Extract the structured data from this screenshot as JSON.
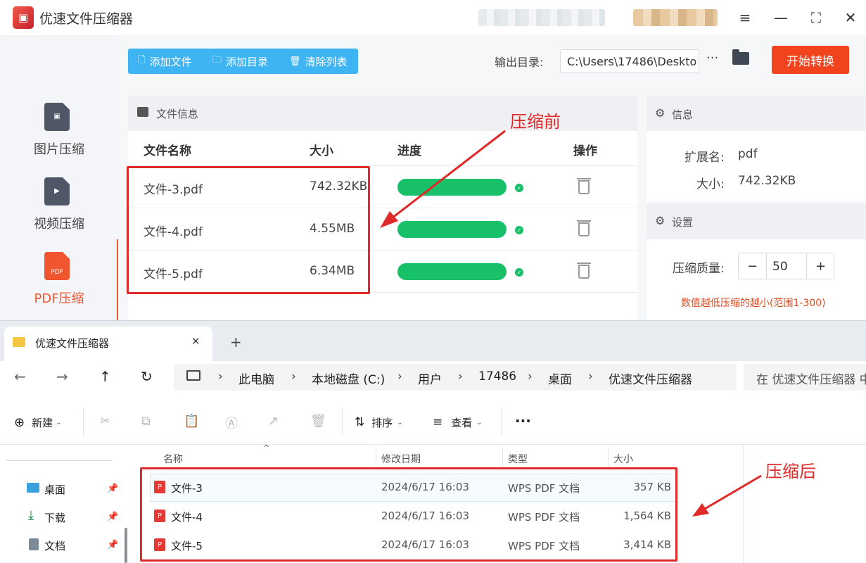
{
  "app": {
    "title": "优速文件压缩器",
    "logo_glyph": "▣"
  },
  "sidebar": {
    "items": [
      {
        "label": "图片压缩",
        "icon": "image-file-icon",
        "active": false
      },
      {
        "label": "视频压缩",
        "icon": "video-file-icon",
        "active": false
      },
      {
        "label": "PDF压缩",
        "icon": "pdf-file-icon",
        "active": true,
        "icon_text": "PDF"
      }
    ],
    "active_color": "#f0552f"
  },
  "toolbar": {
    "add_file": "添加文件",
    "add_folder": "添加目录",
    "clear_list": "清除列表",
    "output_label": "输出目录:",
    "output_path": "C:\\Users\\17486\\Deskto",
    "more": "···",
    "start_button": "开始转换",
    "accent": "#3fb4f2",
    "start_color": "#f0431e"
  },
  "file_panel": {
    "title": "文件信息",
    "columns": [
      "文件名称",
      "大小",
      "进度",
      "操作"
    ],
    "rows": [
      {
        "name": "文件-3.pdf",
        "size": "742.32KB",
        "progress": 1.0
      },
      {
        "name": "文件-4.pdf",
        "size": "4.55MB",
        "progress": 1.0
      },
      {
        "name": "文件-5.pdf",
        "size": "6.34MB",
        "progress": 1.0
      }
    ],
    "progress_color": "#19c06a"
  },
  "info_panel": {
    "title": "信息",
    "ext_label": "扩展名:",
    "ext_value": "pdf",
    "size_label": "大小:",
    "size_value": "742.32KB"
  },
  "settings_panel": {
    "title": "设置",
    "quality_label": "压缩质量:",
    "quality_value": "50",
    "minus": "−",
    "plus": "+",
    "hint": "数值越低压缩的越小(范围1-300)"
  },
  "annotations": {
    "before": "压缩前",
    "after": "压缩后",
    "color": "#e02a2a"
  },
  "explorer": {
    "tab_title": "优速文件压缩器",
    "tab_close": "✕",
    "new_tab": "+",
    "breadcrumbs": [
      "此电脑",
      "本地磁盘 (C:)",
      "用户",
      "17486",
      "桌面",
      "优速文件压缩器"
    ],
    "search_placeholder": "在 优速文件压缩器 中",
    "commands": {
      "new": "新建",
      "sort": "排序",
      "view": "查看",
      "more": "···"
    },
    "nav_items": [
      {
        "label": "桌面"
      },
      {
        "label": "下载"
      },
      {
        "label": "文档"
      }
    ],
    "columns": [
      "名称",
      "修改日期",
      "类型",
      "大小"
    ],
    "files": [
      {
        "name": "文件-3",
        "date": "2024/6/17 16:03",
        "type": "WPS PDF 文档",
        "size": "357 KB"
      },
      {
        "name": "文件-4",
        "date": "2024/6/17 16:03",
        "type": "WPS PDF 文档",
        "size": "1,564 KB"
      },
      {
        "name": "文件-5",
        "date": "2024/6/17 16:03",
        "type": "WPS PDF 文档",
        "size": "3,414 KB"
      }
    ]
  }
}
